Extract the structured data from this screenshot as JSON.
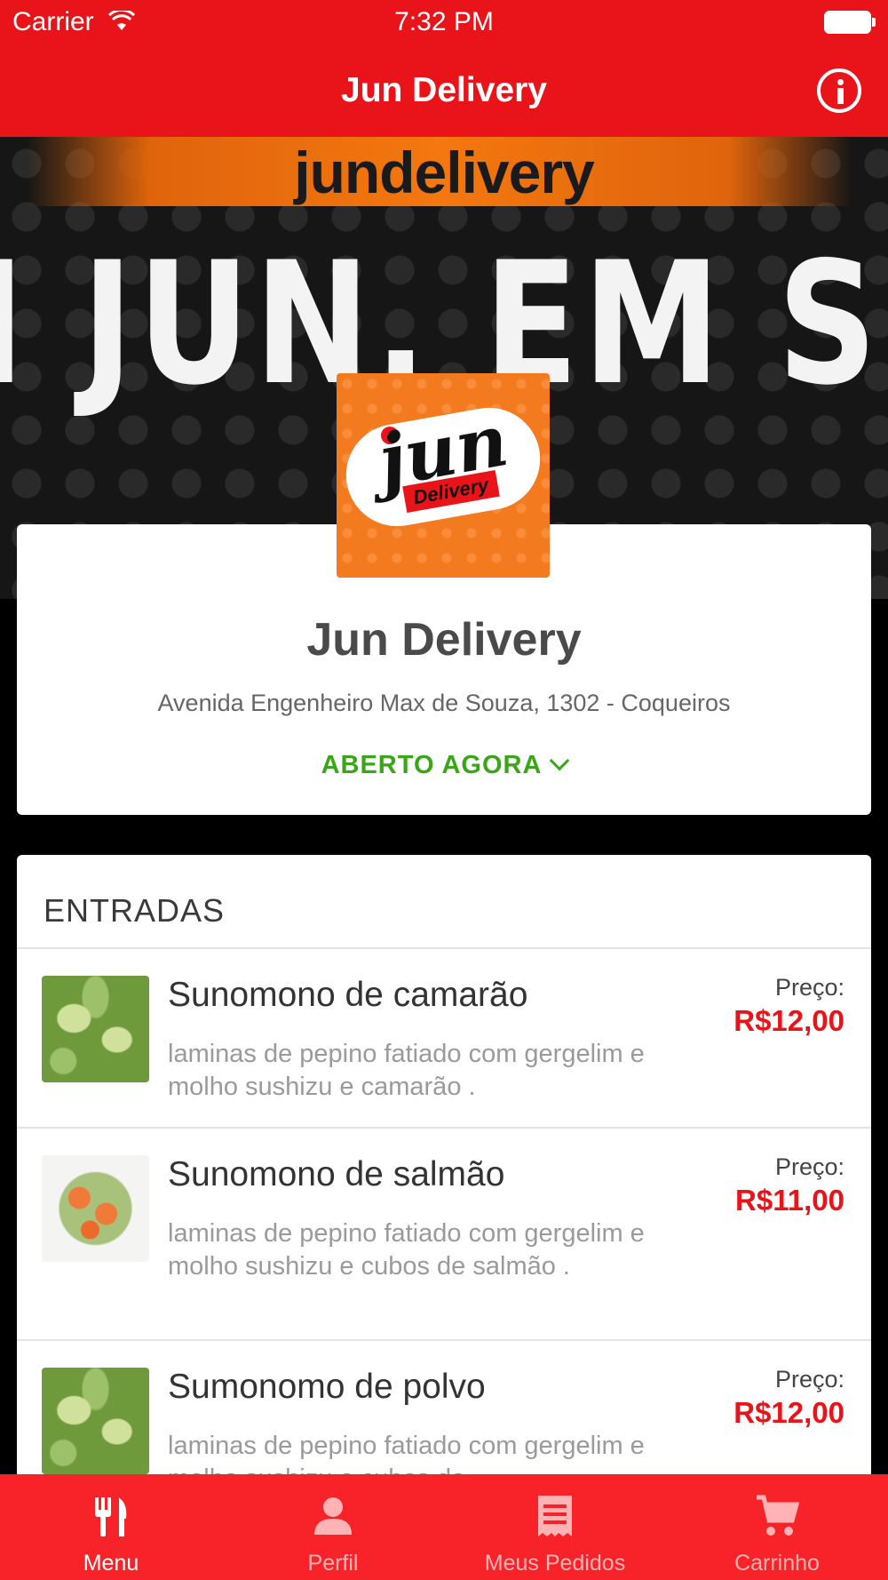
{
  "status_bar": {
    "carrier": "Carrier",
    "time": "7:32 PM"
  },
  "nav": {
    "title": "Jun Delivery"
  },
  "banner": {
    "handle": "jundelivery",
    "headline": "I JUN. EM SUA"
  },
  "logo": {
    "text": "jun",
    "subtext": "Delivery"
  },
  "restaurant": {
    "name": "Jun Delivery",
    "address": "Avenida Engenheiro Max de Souza, 1302 - Coqueiros",
    "status": "ABERTO AGORA"
  },
  "menu": {
    "section_title": "ENTRADAS",
    "price_label": "Preço:",
    "items": [
      {
        "name": "Sunomono de camarão",
        "description": "laminas de pepino fatiado com gergelim e molho sushizu  e camarão .",
        "price": "R$12,00"
      },
      {
        "name": "Sunomono de salmão",
        "description": "laminas de pepino fatiado com gergelim e molho sushizu  e cubos de salmão .",
        "price": "R$11,00"
      },
      {
        "name": "Sumonomo de polvo",
        "description": "laminas de pepino fatiado com gergelim e molho sushizu  e cubos de",
        "price": "R$12,00"
      }
    ]
  },
  "tabs": [
    {
      "label": "Menu",
      "icon": "fork-knife-icon",
      "active": true
    },
    {
      "label": "Perfil",
      "icon": "person-icon",
      "active": false
    },
    {
      "label": "Meus Pedidos",
      "icon": "receipt-icon",
      "active": false
    },
    {
      "label": "Carrinho",
      "icon": "cart-icon",
      "active": false
    }
  ],
  "colors": {
    "brand_red": "#e8141a",
    "open_green": "#3aa617",
    "price_red": "#e8141a"
  }
}
